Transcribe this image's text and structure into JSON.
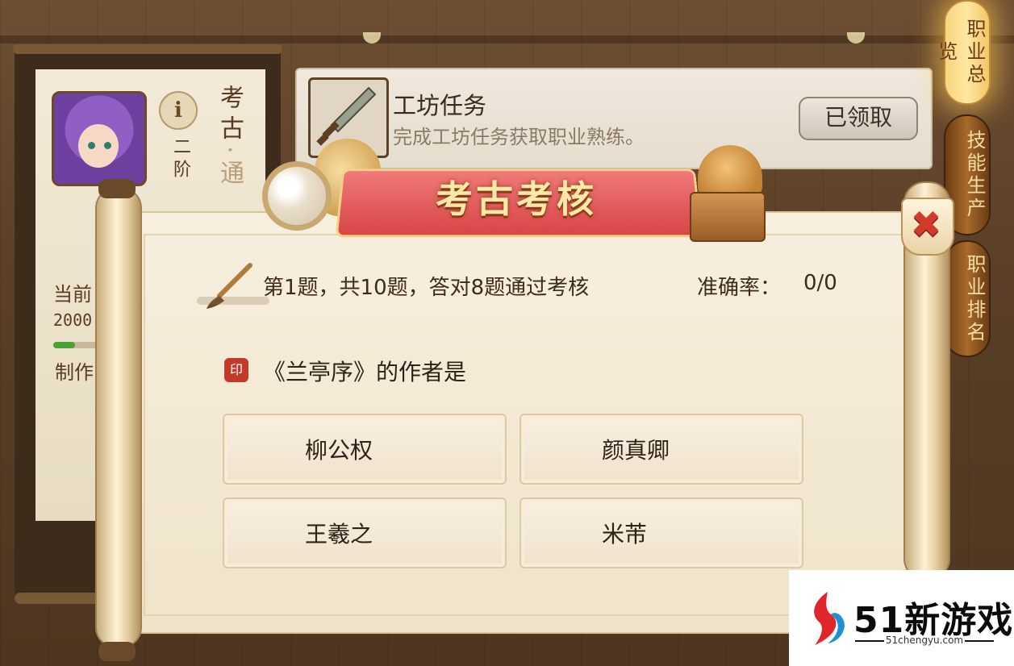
{
  "profile": {
    "rank": "二阶",
    "job_title": "考古",
    "job_suffix": "·通",
    "current_label": "当前",
    "current_value": "2000",
    "production_label": "制作"
  },
  "task": {
    "title": "工坊任务",
    "description": "完成工坊任务获取职业熟练。",
    "claim_button": "已领取"
  },
  "side_tabs": [
    {
      "label": "职业总览",
      "active": true
    },
    {
      "label": "技能生产",
      "active": false
    },
    {
      "label": "职业排名",
      "active": false
    }
  ],
  "quiz": {
    "banner_title": "考古考核",
    "progress_text": "第1题，共10题，答对8题通过考核",
    "accuracy_label": "准确率：",
    "accuracy_value": "0/0",
    "question": "《兰亭序》的作者是",
    "options": [
      "柳公权",
      "颜真卿",
      "王羲之",
      "米芾"
    ]
  },
  "watermark": {
    "brand": "51新游戏",
    "url": "51chengyu.com"
  },
  "colors": {
    "accent_red": "#d94545",
    "gold": "#f6d67e",
    "progress_green": "#4aa136"
  }
}
